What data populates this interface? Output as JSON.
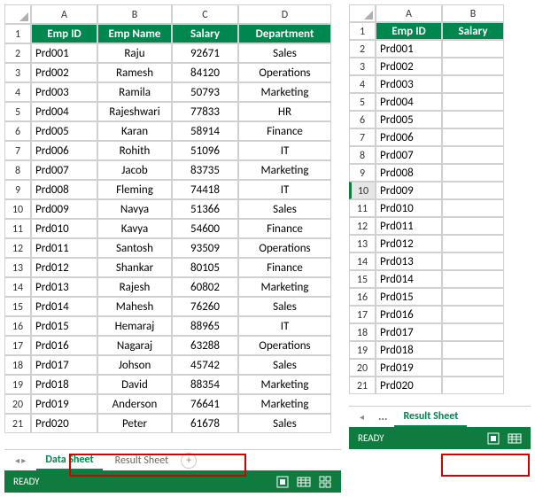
{
  "left": {
    "columns": [
      "A",
      "B",
      "C",
      "D"
    ],
    "headers": [
      "Emp ID",
      "Emp Name",
      "Salary",
      "Department"
    ],
    "rows": [
      {
        "n": "2",
        "c": [
          "Prd001",
          "Raju",
          "92671",
          "Sales"
        ]
      },
      {
        "n": "3",
        "c": [
          "Prd002",
          "Ramesh",
          "84120",
          "Operations"
        ]
      },
      {
        "n": "4",
        "c": [
          "Prd003",
          "Ramila",
          "50793",
          "Marketing"
        ]
      },
      {
        "n": "5",
        "c": [
          "Prd004",
          "Rajeshwari",
          "77833",
          "HR"
        ]
      },
      {
        "n": "6",
        "c": [
          "Prd005",
          "Karan",
          "58914",
          "Finance"
        ]
      },
      {
        "n": "7",
        "c": [
          "Prd006",
          "Rohith",
          "51096",
          "IT"
        ]
      },
      {
        "n": "8",
        "c": [
          "Prd007",
          "Jacob",
          "83735",
          "Marketing"
        ]
      },
      {
        "n": "9",
        "c": [
          "Prd008",
          "Fleming",
          "74418",
          "IT"
        ]
      },
      {
        "n": "10",
        "c": [
          "Prd009",
          "Navya",
          "51366",
          "Sales"
        ]
      },
      {
        "n": "11",
        "c": [
          "Prd010",
          "Kavya",
          "54600",
          "Finance"
        ]
      },
      {
        "n": "12",
        "c": [
          "Prd011",
          "Santosh",
          "93509",
          "Operations"
        ]
      },
      {
        "n": "13",
        "c": [
          "Prd012",
          "Shankar",
          "80105",
          "Finance"
        ]
      },
      {
        "n": "14",
        "c": [
          "Prd013",
          "Rajesh",
          "60802",
          "Marketing"
        ]
      },
      {
        "n": "15",
        "c": [
          "Prd014",
          "Mahesh",
          "76260",
          "Sales"
        ]
      },
      {
        "n": "16",
        "c": [
          "Prd015",
          "Hemaraj",
          "88965",
          "IT"
        ]
      },
      {
        "n": "17",
        "c": [
          "Prd016",
          "Nagaraj",
          "63288",
          "Operations"
        ]
      },
      {
        "n": "18",
        "c": [
          "Prd017",
          "Johson",
          "45742",
          "Sales"
        ]
      },
      {
        "n": "19",
        "c": [
          "Prd018",
          "David",
          "88354",
          "Marketing"
        ]
      },
      {
        "n": "20",
        "c": [
          "Prd019",
          "Anderson",
          "76641",
          "Marketing"
        ]
      },
      {
        "n": "21",
        "c": [
          "Prd020",
          "Peter",
          "61678",
          "Sales"
        ]
      }
    ],
    "tabs": {
      "active": "Data Sheet",
      "other": "Result Sheet"
    },
    "status": "READY"
  },
  "right": {
    "columns": [
      "A",
      "B"
    ],
    "headers": [
      "Emp ID",
      "Salary"
    ],
    "rows": [
      {
        "n": "2",
        "c": [
          "Prd001",
          ""
        ]
      },
      {
        "n": "3",
        "c": [
          "Prd002",
          ""
        ]
      },
      {
        "n": "4",
        "c": [
          "Prd003",
          ""
        ]
      },
      {
        "n": "5",
        "c": [
          "Prd004",
          ""
        ]
      },
      {
        "n": "6",
        "c": [
          "Prd005",
          ""
        ]
      },
      {
        "n": "7",
        "c": [
          "Prd006",
          ""
        ]
      },
      {
        "n": "8",
        "c": [
          "Prd007",
          ""
        ]
      },
      {
        "n": "9",
        "c": [
          "Prd008",
          ""
        ]
      },
      {
        "n": "10",
        "c": [
          "Prd009",
          ""
        ],
        "sel": true
      },
      {
        "n": "11",
        "c": [
          "Prd010",
          ""
        ]
      },
      {
        "n": "12",
        "c": [
          "Prd011",
          ""
        ]
      },
      {
        "n": "13",
        "c": [
          "Prd012",
          ""
        ]
      },
      {
        "n": "14",
        "c": [
          "Prd013",
          ""
        ]
      },
      {
        "n": "15",
        "c": [
          "Prd014",
          ""
        ]
      },
      {
        "n": "16",
        "c": [
          "Prd015",
          ""
        ]
      },
      {
        "n": "17",
        "c": [
          "Prd016",
          ""
        ]
      },
      {
        "n": "18",
        "c": [
          "Prd017",
          ""
        ]
      },
      {
        "n": "19",
        "c": [
          "Prd018",
          ""
        ]
      },
      {
        "n": "20",
        "c": [
          "Prd019",
          ""
        ]
      },
      {
        "n": "21",
        "c": [
          "Prd020",
          ""
        ]
      }
    ],
    "tabs": {
      "active": "Result Sheet"
    },
    "status": "READY"
  },
  "chart_data": {
    "type": "table",
    "title": "Data Sheet",
    "columns": [
      "Emp ID",
      "Emp Name",
      "Salary",
      "Department"
    ],
    "rows": [
      [
        "Prd001",
        "Raju",
        92671,
        "Sales"
      ],
      [
        "Prd002",
        "Ramesh",
        84120,
        "Operations"
      ],
      [
        "Prd003",
        "Ramila",
        50793,
        "Marketing"
      ],
      [
        "Prd004",
        "Rajeshwari",
        77833,
        "HR"
      ],
      [
        "Prd005",
        "Karan",
        58914,
        "Finance"
      ],
      [
        "Prd006",
        "Rohith",
        51096,
        "IT"
      ],
      [
        "Prd007",
        "Jacob",
        83735,
        "Marketing"
      ],
      [
        "Prd008",
        "Fleming",
        74418,
        "IT"
      ],
      [
        "Prd009",
        "Navya",
        51366,
        "Sales"
      ],
      [
        "Prd010",
        "Kavya",
        54600,
        "Finance"
      ],
      [
        "Prd011",
        "Santosh",
        93509,
        "Operations"
      ],
      [
        "Prd012",
        "Shankar",
        80105,
        "Finance"
      ],
      [
        "Prd013",
        "Rajesh",
        60802,
        "Marketing"
      ],
      [
        "Prd014",
        "Mahesh",
        76260,
        "Sales"
      ],
      [
        "Prd015",
        "Hemaraj",
        88965,
        "IT"
      ],
      [
        "Prd016",
        "Nagaraj",
        63288,
        "Operations"
      ],
      [
        "Prd017",
        "Johson",
        45742,
        "Sales"
      ],
      [
        "Prd018",
        "David",
        88354,
        "Marketing"
      ],
      [
        "Prd019",
        "Anderson",
        76641,
        "Marketing"
      ],
      [
        "Prd020",
        "Peter",
        61678,
        "Sales"
      ]
    ]
  }
}
